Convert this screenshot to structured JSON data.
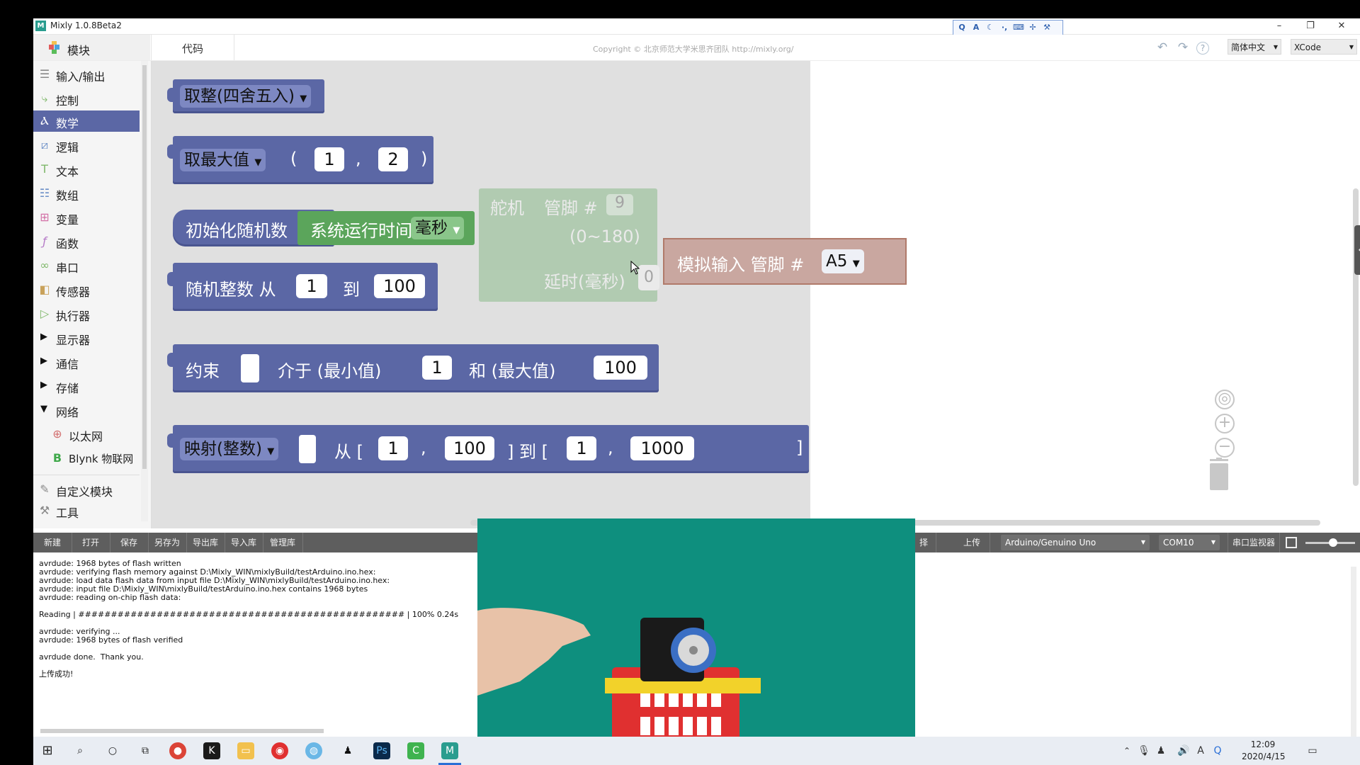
{
  "window": {
    "title": "Mixly 1.0.8Beta2",
    "minimize": "–",
    "maximize": "❐",
    "close": "✕"
  },
  "toolbar": {
    "modules_tab": "模块",
    "code_tab": "代码",
    "copyright": "Copyright © 北京师范大学米思齐团队 http://mixly.org/",
    "language": "简体中文",
    "theme": "XCode"
  },
  "sidebar": {
    "categories": [
      {
        "label": "输入/输出",
        "icon": "io-icon"
      },
      {
        "label": "控制",
        "icon": "control-icon"
      },
      {
        "label": "数学",
        "icon": "math-icon"
      },
      {
        "label": "逻辑",
        "icon": "logic-icon"
      },
      {
        "label": "文本",
        "icon": "text-icon"
      },
      {
        "label": "数组",
        "icon": "list-icon"
      },
      {
        "label": "变量",
        "icon": "variable-icon"
      },
      {
        "label": "函数",
        "icon": "function-icon"
      },
      {
        "label": "串口",
        "icon": "serial-icon"
      },
      {
        "label": "传感器",
        "icon": "sensor-icon"
      },
      {
        "label": "执行器",
        "icon": "actuator-icon"
      },
      {
        "label": "显示器",
        "icon": "expand-icon"
      },
      {
        "label": "通信",
        "icon": "expand-icon"
      },
      {
        "label": "存储",
        "icon": "expand-icon"
      },
      {
        "label": "网络",
        "icon": "collapse-icon"
      },
      {
        "label": "以太网",
        "icon": "ethernet-icon"
      },
      {
        "label": "Blynk 物联网",
        "icon": "blynk-icon"
      },
      {
        "label": "自定义模块",
        "icon": "custom-icon"
      },
      {
        "label": "工具",
        "icon": "tools-icon"
      }
    ]
  },
  "blocks": {
    "round": {
      "label": "取整(四舍五入)"
    },
    "max": {
      "label": "取最大值",
      "open": "(",
      "a": "1",
      "comma": ",",
      "b": "2",
      "close": ")"
    },
    "seed": {
      "label": "初始化随机数",
      "sys": "系统运行时间",
      "unit": "毫秒"
    },
    "randint": {
      "label": "随机整数 从",
      "from": "1",
      "to_label": "到",
      "to": "100"
    },
    "constrain": {
      "label": "约束",
      "between": "介于 (最小值)",
      "min": "1",
      "and_label": "和 (最大值)",
      "max": "100"
    },
    "map": {
      "label": "映射(整数)",
      "from_label": "从 [",
      "a": "1",
      "comma1": ",",
      "b": "100",
      "to_label": "] 到 [",
      "c": "1",
      "comma2": ",",
      "d": "1000",
      "end": "]"
    },
    "ghost_servo": {
      "label": "舵机",
      "pin_label": "管脚 #",
      "pin": "9",
      "range": "(0~180)",
      "delay": "延时(毫秒)",
      "delay_val": "0"
    },
    "ghost_analog": {
      "label": "模拟输入 管脚 #",
      "pin": "A5"
    }
  },
  "bottom_toolbar": {
    "buttons": [
      "新建",
      "打开",
      "保存",
      "另存为",
      "导出库",
      "导入库",
      "管理库"
    ],
    "select_label": "择",
    "upload": "上传",
    "board": "Arduino/Genuino Uno",
    "port": "COM10",
    "serial_monitor": "串口监视器"
  },
  "console": {
    "lines": [
      "avrdude: 1968 bytes of flash written",
      "avrdude: verifying flash memory against D:\\Mixly_WIN\\mixlyBuild/testArduino.ino.hex:",
      "avrdude: load data flash data from input file D:\\Mixly_WIN\\mixlyBuild/testArduino.ino.hex:",
      "avrdude: input file D:\\Mixly_WIN\\mixlyBuild/testArduino.ino.hex contains 1968 bytes",
      "avrdude: reading on-chip flash data:",
      "",
      "Reading | ################################################## | 100% 0.24s",
      "",
      "avrdude: verifying ...",
      "avrdude: 1968 bytes of flash verified",
      "",
      "avrdude done.  Thank you.",
      "",
      "上传成功!"
    ]
  },
  "taskbar": {
    "time": "12:09",
    "date": "2020/4/15"
  },
  "colors": {
    "math_block": "#5b67a5",
    "green_block": "#5ba55b",
    "flyout_bg": "#e0e0e0",
    "video_bg": "#0e8f7e"
  }
}
